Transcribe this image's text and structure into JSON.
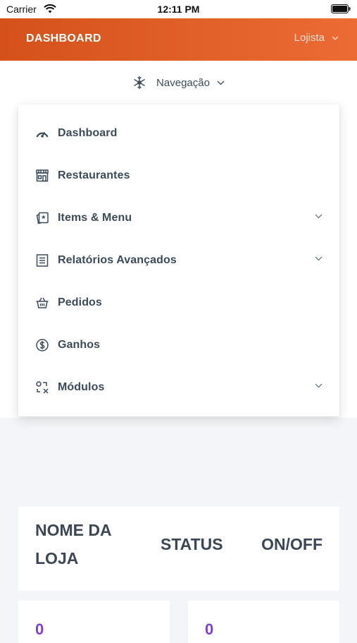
{
  "status_bar": {
    "carrier": "Carrier",
    "time": "12:11 PM"
  },
  "header": {
    "title": "DASHBOARD",
    "user": "Lojista"
  },
  "nav": {
    "label": "Navegação"
  },
  "menu": {
    "items": [
      {
        "label": "Dashboard",
        "icon": "speedometer-icon",
        "has_submenu": false
      },
      {
        "label": "Restaurantes",
        "icon": "storefront-icon",
        "has_submenu": false
      },
      {
        "label": "Items & Menu",
        "icon": "menu-card-icon",
        "has_submenu": true
      },
      {
        "label": "Relatórios Avançados",
        "icon": "report-icon",
        "has_submenu": true
      },
      {
        "label": "Pedidos",
        "icon": "basket-icon",
        "has_submenu": false
      },
      {
        "label": "Ganhos",
        "icon": "dollar-icon",
        "has_submenu": false
      },
      {
        "label": "Módulos",
        "icon": "modules-icon",
        "has_submenu": true
      }
    ]
  },
  "table": {
    "col_name": "NOME DA LOJA",
    "col_status": "STATUS",
    "col_onoff": "ON/OFF"
  },
  "stats": [
    {
      "value": "0"
    },
    {
      "value": "0"
    }
  ],
  "colors": {
    "header_start": "#d4521a",
    "header_end": "#ec6a34",
    "stat_value": "#7e3fd6"
  }
}
